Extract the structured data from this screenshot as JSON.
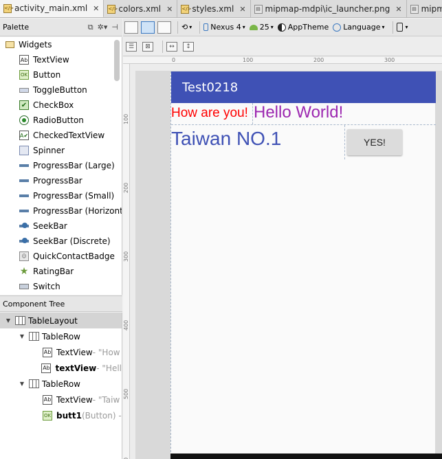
{
  "tabs": [
    {
      "label": "activity_main.xml",
      "icon": "xml-file-icon",
      "active": true
    },
    {
      "label": "colors.xml",
      "icon": "xml-file-icon"
    },
    {
      "label": "styles.xml",
      "icon": "xml-file-icon"
    },
    {
      "label": "mipmap-mdpi\\ic_launcher.png",
      "icon": "png-file-icon"
    },
    {
      "label": "mipma",
      "icon": "png-file-icon"
    }
  ],
  "palette": {
    "title": "Palette",
    "group": "Widgets",
    "items": [
      {
        "label": "TextView",
        "icon": "ab"
      },
      {
        "label": "Button",
        "icon": "ok"
      },
      {
        "label": "ToggleButton",
        "icon": "toggle"
      },
      {
        "label": "CheckBox",
        "icon": "check"
      },
      {
        "label": "RadioButton",
        "icon": "radio"
      },
      {
        "label": "CheckedTextView",
        "icon": "ctv"
      },
      {
        "label": "Spinner",
        "icon": "spinner"
      },
      {
        "label": "ProgressBar (Large)",
        "icon": "progress"
      },
      {
        "label": "ProgressBar",
        "icon": "progress"
      },
      {
        "label": "ProgressBar (Small)",
        "icon": "progress"
      },
      {
        "label": "ProgressBar (Horizonta",
        "icon": "progress"
      },
      {
        "label": "SeekBar",
        "icon": "seek"
      },
      {
        "label": "SeekBar (Discrete)",
        "icon": "seek"
      },
      {
        "label": "QuickContactBadge",
        "icon": "badge"
      },
      {
        "label": "RatingBar",
        "icon": "star"
      },
      {
        "label": "Switch",
        "icon": "switch"
      }
    ]
  },
  "component_tree": {
    "title": "Component Tree",
    "nodes": [
      {
        "label": "TableLayout",
        "hint": "",
        "level": 0,
        "type": "table",
        "selected": true
      },
      {
        "label": "TableRow",
        "hint": "",
        "level": 1,
        "type": "table"
      },
      {
        "label": "TextView",
        "hint": " - \"How",
        "level": 2,
        "type": "ab"
      },
      {
        "label": "textView",
        "hint": " - \"Hell",
        "level": 2,
        "type": "ab",
        "bold": true
      },
      {
        "label": "TableRow",
        "hint": "",
        "level": 1,
        "type": "table"
      },
      {
        "label": "TextView",
        "hint": " - \"Taiw",
        "level": 2,
        "type": "ab"
      },
      {
        "label": "butt1",
        "hint": " (Button) -",
        "level": 2,
        "type": "ok",
        "bold": true
      }
    ]
  },
  "toolbar": {
    "device": "Nexus 4",
    "api": "25",
    "theme": "AppTheme",
    "language": "Language"
  },
  "rulers": {
    "top": [
      "0",
      "100",
      "200",
      "300"
    ],
    "left": [
      "100",
      "200",
      "300",
      "400",
      "500",
      "600"
    ]
  },
  "phone": {
    "app_title": "Test0218",
    "row1": {
      "text1": "How are you!",
      "text2": "Hello World!"
    },
    "row2": {
      "text1": "Taiwan NO.1",
      "button": "YES!"
    },
    "colors": {
      "appbar": "#3f51b5",
      "text_red": "#ff0000",
      "text_purple": "#9c27b0",
      "text_indigo": "#3f51b5"
    }
  }
}
